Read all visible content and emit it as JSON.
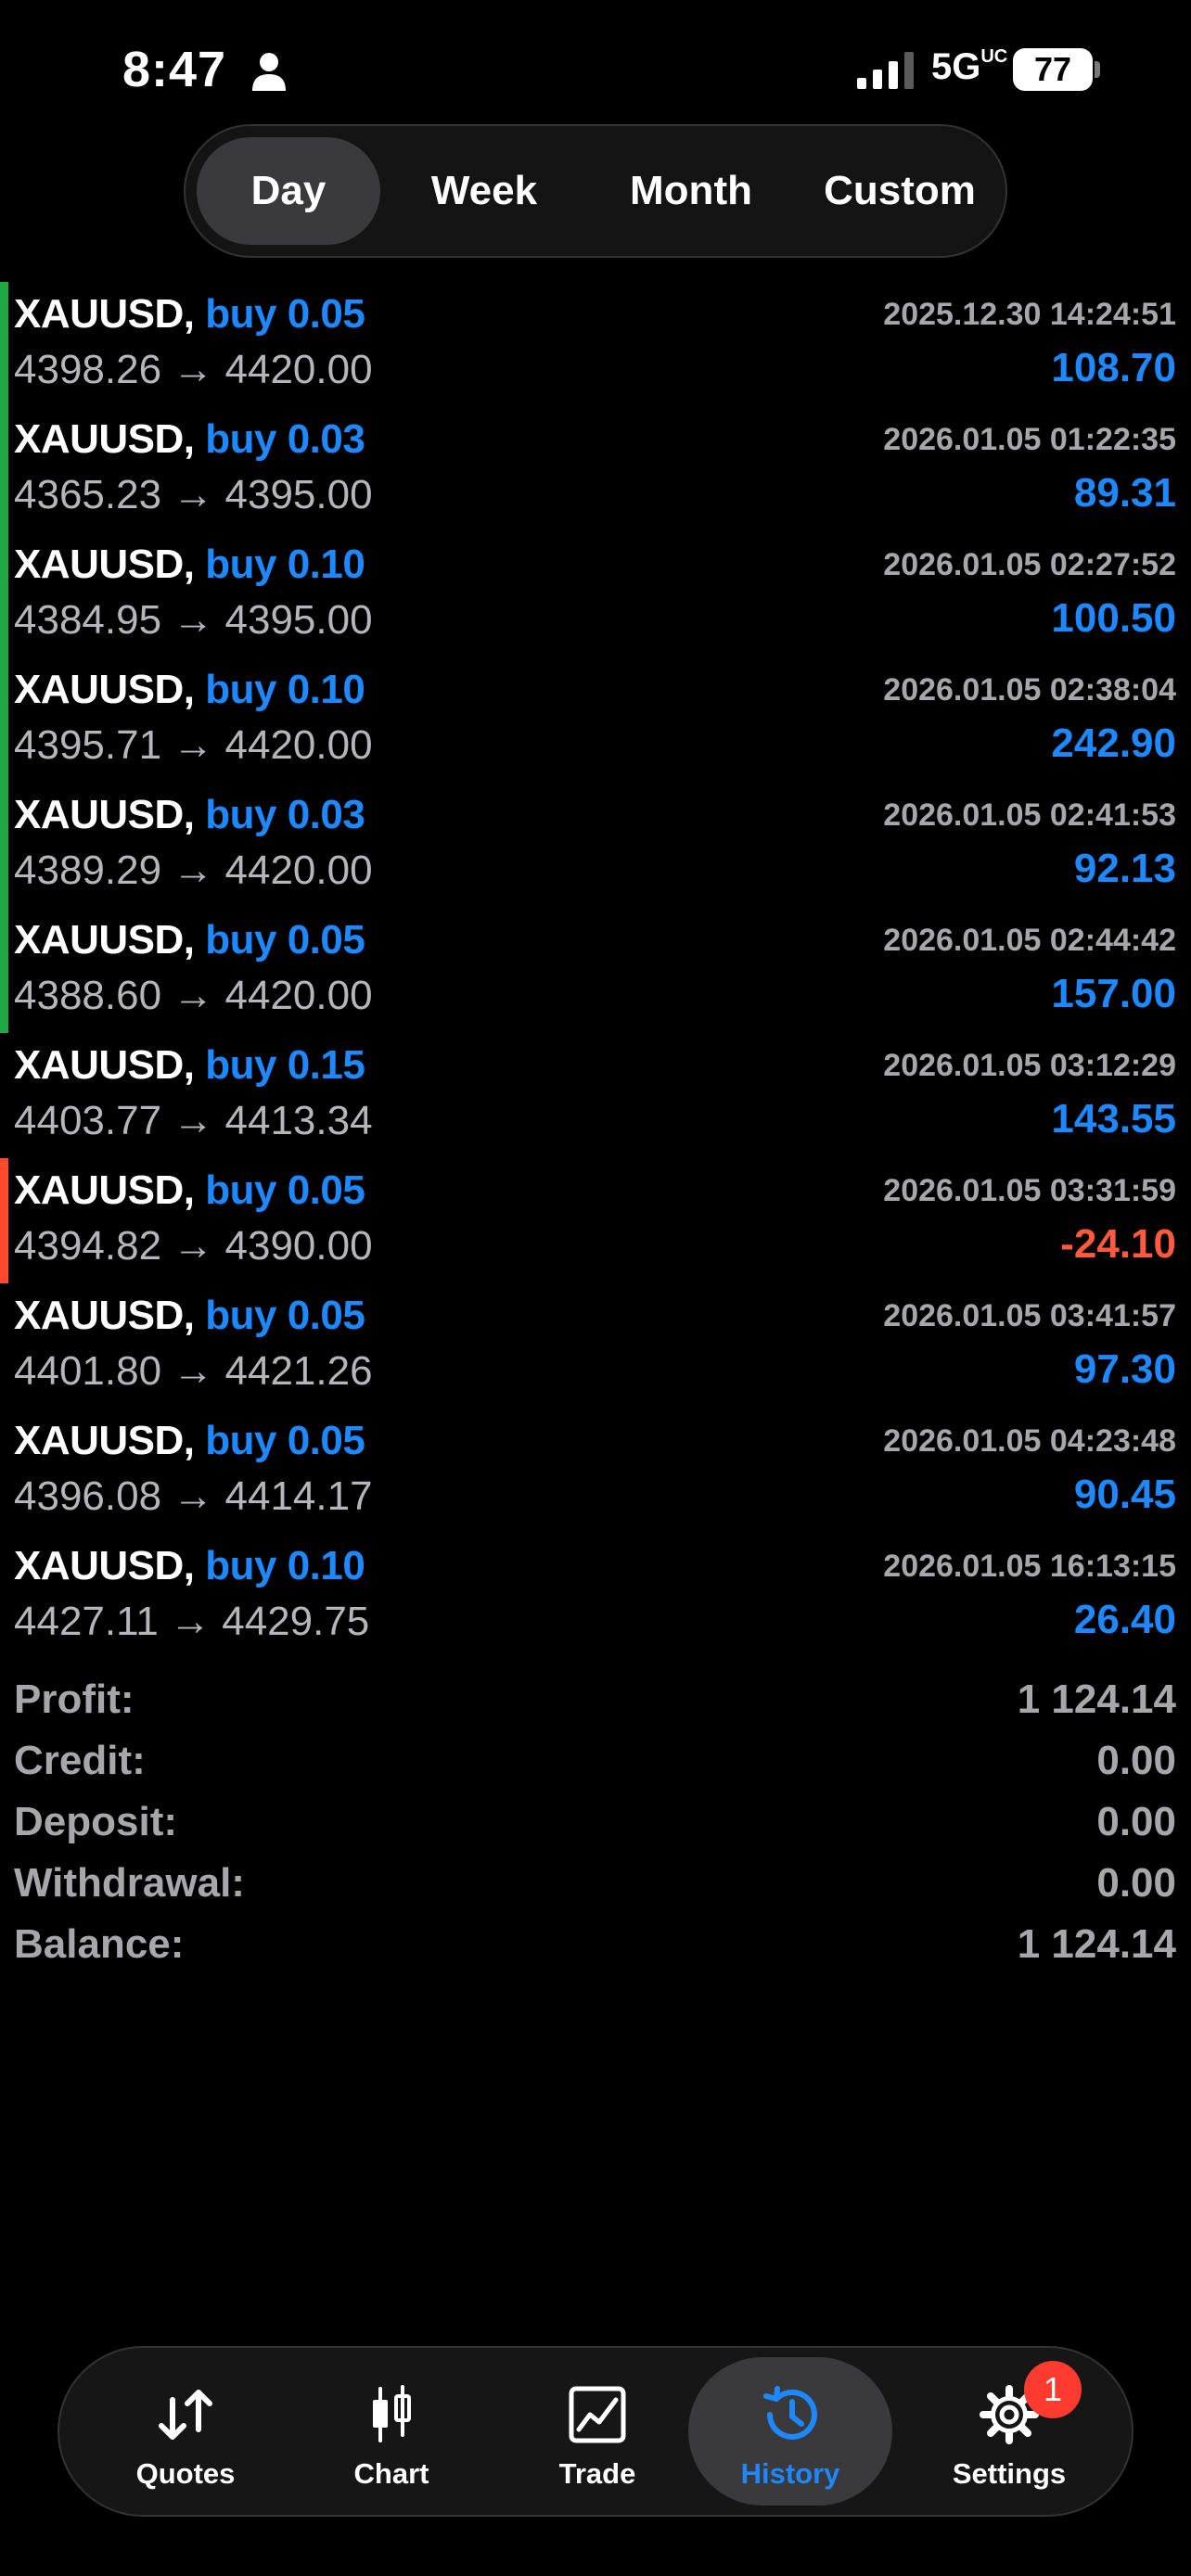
{
  "status_bar": {
    "time": "8:47",
    "network": "5G",
    "network_superscript": "UC",
    "battery": "77",
    "icons": [
      "person-icon",
      "signal-icon",
      "battery-icon"
    ]
  },
  "period_tabs": {
    "selected": "Day",
    "items": [
      {
        "label": "Day"
      },
      {
        "label": "Week"
      },
      {
        "label": "Month"
      },
      {
        "label": "Custom"
      }
    ]
  },
  "colors": {
    "profit": "#1e88ff",
    "loss": "#ff5a3c",
    "bar_green": "#1fa843",
    "bar_red": "#ff4a2e"
  },
  "deals": [
    {
      "symbol": "XAUUSD,",
      "side": "buy 0.05",
      "open_close": "4398.26 → 4420.00",
      "datetime": "2025.12.30 14:24:51",
      "profit": "108.70",
      "bar": "green"
    },
    {
      "symbol": "XAUUSD,",
      "side": "buy 0.03",
      "open_close": "4365.23 → 4395.00",
      "datetime": "2026.01.05 01:22:35",
      "profit": "89.31",
      "bar": "green"
    },
    {
      "symbol": "XAUUSD,",
      "side": "buy 0.10",
      "open_close": "4384.95 → 4395.00",
      "datetime": "2026.01.05 02:27:52",
      "profit": "100.50",
      "bar": "green"
    },
    {
      "symbol": "XAUUSD,",
      "side": "buy 0.10",
      "open_close": "4395.71 → 4420.00",
      "datetime": "2026.01.05 02:38:04",
      "profit": "242.90",
      "bar": "green"
    },
    {
      "symbol": "XAUUSD,",
      "side": "buy 0.03",
      "open_close": "4389.29 → 4420.00",
      "datetime": "2026.01.05 02:41:53",
      "profit": "92.13",
      "bar": "green"
    },
    {
      "symbol": "XAUUSD,",
      "side": "buy 0.05",
      "open_close": "4388.60 → 4420.00",
      "datetime": "2026.01.05 02:44:42",
      "profit": "157.00",
      "bar": "green"
    },
    {
      "symbol": "XAUUSD,",
      "side": "buy 0.15",
      "open_close": "4403.77 → 4413.34",
      "datetime": "2026.01.05 03:12:29",
      "profit": "143.55",
      "bar": "none"
    },
    {
      "symbol": "XAUUSD,",
      "side": "buy 0.05",
      "open_close": "4394.82 → 4390.00",
      "datetime": "2026.01.05 03:31:59",
      "profit": "-24.10",
      "bar": "red"
    },
    {
      "symbol": "XAUUSD,",
      "side": "buy 0.05",
      "open_close": "4401.80 → 4421.26",
      "datetime": "2026.01.05 03:41:57",
      "profit": "97.30",
      "bar": "none"
    },
    {
      "symbol": "XAUUSD,",
      "side": "buy 0.05",
      "open_close": "4396.08 → 4414.17",
      "datetime": "2026.01.05 04:23:48",
      "profit": "90.45",
      "bar": "none"
    },
    {
      "symbol": "XAUUSD,",
      "side": "buy 0.10",
      "open_close": "4427.11 → 4429.75",
      "datetime": "2026.01.05 16:13:15",
      "profit": "26.40",
      "bar": "none"
    }
  ],
  "summary": [
    {
      "label": "Profit:",
      "value": "1 124.14"
    },
    {
      "label": "Credit:",
      "value": "0.00"
    },
    {
      "label": "Deposit:",
      "value": "0.00"
    },
    {
      "label": "Withdrawal:",
      "value": "0.00"
    },
    {
      "label": "Balance:",
      "value": "1 124.14"
    }
  ],
  "tab_bar": {
    "selected": "History",
    "items": [
      {
        "label": "Quotes",
        "icon": "quotes-arrows-icon"
      },
      {
        "label": "Chart",
        "icon": "candlestick-chart-icon"
      },
      {
        "label": "Trade",
        "icon": "trade-chart-icon"
      },
      {
        "label": "History",
        "icon": "history-clock-icon"
      },
      {
        "label": "Settings",
        "icon": "gear-icon"
      }
    ],
    "settings_badge": "1"
  }
}
